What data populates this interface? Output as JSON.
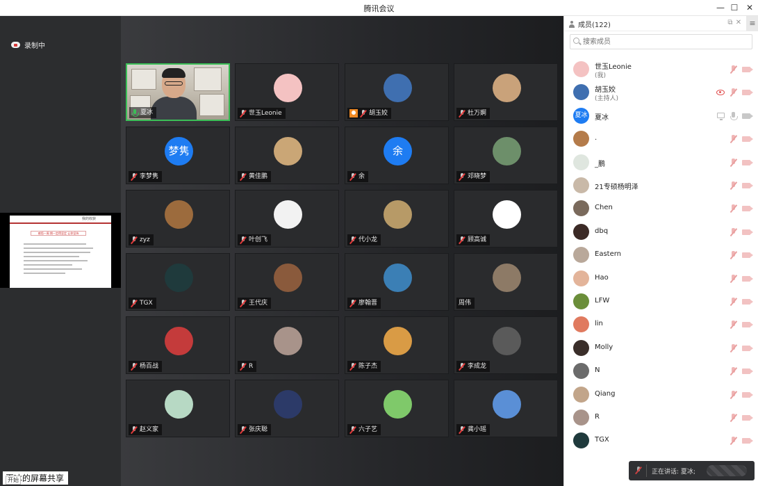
{
  "window": {
    "title": "腾讯会议",
    "minimize": "—",
    "maximize": "☐",
    "close": "✕"
  },
  "left": {
    "recording": "录制中",
    "share_label": "夏冰的屏幕共享",
    "start_label": "开始",
    "slide_header": "我的收获",
    "slide_banner": "感悟一周  期一定得坚定  让你坚持"
  },
  "tiles": [
    {
      "name": "夏冰",
      "kind": "video",
      "mic": "on",
      "active": true
    },
    {
      "name": "世玉Leonie",
      "kind": "avatar",
      "color": "#f4c2c2"
    },
    {
      "name": "胡玉姣",
      "kind": "avatar",
      "color": "#3f6fb0",
      "badge": true
    },
    {
      "name": "杜万婀",
      "kind": "avatar",
      "color": "#c9a27a"
    },
    {
      "name": "李梦隽",
      "kind": "text",
      "text": "梦隽",
      "color": "#1e7cf2"
    },
    {
      "name": "黄佳鹏",
      "kind": "avatar",
      "color": "#caa676"
    },
    {
      "name": "余",
      "kind": "text",
      "text": "余",
      "color": "#1e7cf2"
    },
    {
      "name": "邓晓梦",
      "kind": "avatar",
      "color": "#6d8f6a"
    },
    {
      "name": "zyz",
      "kind": "avatar",
      "color": "#9c6b3d"
    },
    {
      "name": "叶创飞",
      "kind": "avatar",
      "color": "#f2f2f2"
    },
    {
      "name": "代小龙",
      "kind": "avatar",
      "color": "#b79a67"
    },
    {
      "name": "顾高诚",
      "kind": "avatar",
      "color": "#ffffff"
    },
    {
      "name": "TGX",
      "kind": "avatar",
      "color": "#1f3a3c"
    },
    {
      "name": "王代庆",
      "kind": "avatar",
      "color": "#8a5a3c"
    },
    {
      "name": "廖翰晋",
      "kind": "avatar",
      "color": "#3b7fb5"
    },
    {
      "name": "周伟",
      "kind": "avatar",
      "color": "#8d7a66",
      "no_mic": true
    },
    {
      "name": "杨百战",
      "kind": "avatar",
      "color": "#c43b3b"
    },
    {
      "name": "R",
      "kind": "avatar",
      "color": "#a8938a"
    },
    {
      "name": "陈子杰",
      "kind": "avatar",
      "color": "#d99b45"
    },
    {
      "name": "李成龙",
      "kind": "avatar",
      "color": "#5a5a5a"
    },
    {
      "name": "赵义家",
      "kind": "avatar",
      "color": "#b7d9c4"
    },
    {
      "name": "张庆聪",
      "kind": "avatar",
      "color": "#2c3a68"
    },
    {
      "name": "六子艺",
      "kind": "avatar",
      "color": "#7fc96a"
    },
    {
      "name": "龚小瑶",
      "kind": "avatar",
      "color": "#5a8fd6"
    }
  ],
  "members": {
    "title": "成员(122)",
    "search_placeholder": "搜索成员",
    "menu": "≡",
    "popout": "⧉",
    "close": "✕",
    "list": [
      {
        "name": "世玉Leonie",
        "sub": "(我)",
        "color": "#f4c2c2",
        "status": "off"
      },
      {
        "name": "胡玉姣",
        "sub": "(主持人)",
        "color": "#3f6fb0",
        "status": "host"
      },
      {
        "name": "夏冰",
        "avatar_text": "夏冰",
        "color": "#1e7cf2",
        "status": "sharing"
      },
      {
        "name": ".",
        "color": "#b47b4a",
        "status": "off"
      },
      {
        "name": "_鹏",
        "color": "#dfe6df",
        "status": "off"
      },
      {
        "name": "21专硕杨明泽",
        "color": "#c9b9a8",
        "status": "off"
      },
      {
        "name": "Chen",
        "color": "#7a6a5c",
        "status": "off"
      },
      {
        "name": "dbq",
        "color": "#3b2a26",
        "status": "off"
      },
      {
        "name": "Eastern",
        "color": "#b9a89a",
        "status": "off"
      },
      {
        "name": "Hao",
        "color": "#e3b49a",
        "status": "off"
      },
      {
        "name": "LFW",
        "color": "#6b8e3a",
        "status": "off"
      },
      {
        "name": "lin",
        "color": "#e07a5f",
        "status": "off"
      },
      {
        "name": "Molly",
        "color": "#3a2e2a",
        "status": "off"
      },
      {
        "name": "N",
        "color": "#6b6b6b",
        "status": "off"
      },
      {
        "name": "Qiang",
        "color": "#c2a58a",
        "status": "off"
      },
      {
        "name": "R",
        "color": "#a8938a",
        "status": "off"
      },
      {
        "name": "TGX",
        "color": "#1f3a3c",
        "status": "off"
      }
    ]
  },
  "speaking": {
    "label": "正在讲话: 夏冰;"
  }
}
